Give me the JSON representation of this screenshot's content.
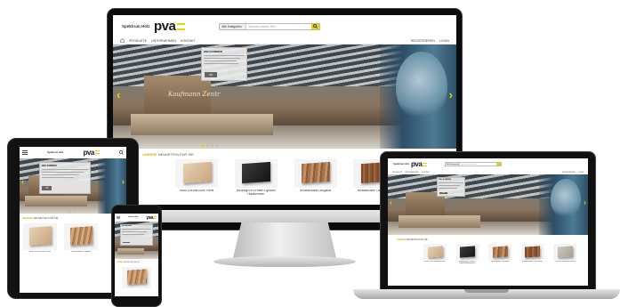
{
  "site": {
    "brand": "Spektrum Holz",
    "logo_text": "pva",
    "search": {
      "category": "Alle Kategorien",
      "placeholder": "Wonach suchen Sie?"
    },
    "nav": {
      "items": [
        "PRODUKTE",
        "UNTERNEHMEN",
        "KONTAKT"
      ],
      "register": "REGISTRIEREN",
      "login": "LOGIN"
    },
    "hero": {
      "sign": "Kaufmann Zentr"
    },
    "popup": {
      "title": "WILLKOMMEN",
      "button": "OK"
    },
    "section": {
      "prefix": "UNSERE",
      "title": "NEUHEITEN FÜR SIE"
    },
    "products": [
      {
        "name": "Auslo 3,5x1mit Erker Fichte",
        "swatch": "w-plain"
      },
      {
        "name": "treDesign HPL/Platte 3-gemmit Holzfurnieren",
        "swatch": "w-dark"
      },
      {
        "name": "Terrassendiele Douglasie",
        "swatch": "w-rustic"
      },
      {
        "name": "Terrassendiele Thermokiefer",
        "swatch": "w-ter"
      },
      {
        "name": "3,5x1mit Paneele Fichte mit",
        "swatch": "w-grey"
      }
    ],
    "tablet_products": [
      {
        "name": "Auslo 3,5x1mit Erker Fichte",
        "swatch": "w-plain"
      },
      {
        "name": "Terrassendiele Douglasie",
        "swatch": "w-oak"
      }
    ],
    "phone_products": [
      {
        "name": "Terrassendiele Douglasie",
        "swatch": "w-oak"
      }
    ]
  },
  "colors": {
    "accent": "#e8d400",
    "brand_text": "#1a1a1a"
  }
}
